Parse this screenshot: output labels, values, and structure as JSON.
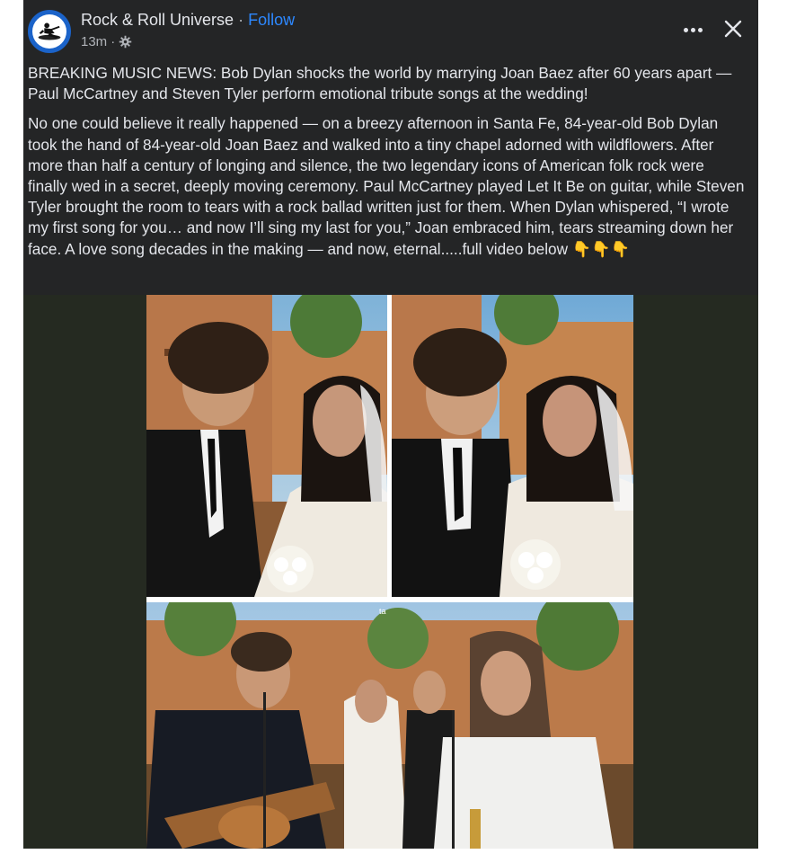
{
  "header": {
    "page_name": "Rock & Roll Universe",
    "separator": "·",
    "follow_label": "Follow",
    "timestamp": "13m",
    "meta_separator": "·",
    "audience_icon": "gear-icon",
    "more_icon": "more-options-icon",
    "close_icon": "close-icon"
  },
  "post": {
    "headline": "BREAKING MUSIC NEWS: Bob Dylan shocks the world by marrying Joan Baez after 60 years apart — Paul McCartney and Steven Tyler perform emotional tribute songs at the wedding!",
    "body": "No one could believe it really happened — on a breezy afternoon in Santa Fe, 84-year-old Bob Dylan took the hand of 84-year-old Joan Baez and walked into a tiny chapel adorned with wildflowers. After more than half a century of longing and silence, the two legendary icons of American folk rock were finally wed in a secret, deeply moving ceremony. Paul McCartney played Let It Be on guitar, while Steven Tyler brought the room to tears with a rock ballad written just for them. When Dylan whispered, “I wrote my first song for you… and now I’ll sing my last for you,” Joan embraced him, tears streaming down her face. A love song decades in the making — and now, eternal.....full video below",
    "emoji": "👇👇👇"
  },
  "media": {
    "watermark": "ta",
    "photos": [
      "wedding-couple-photo-left",
      "wedding-couple-photo-right",
      "wedding-performance-photo"
    ]
  },
  "colors": {
    "card_bg": "#242526",
    "text": "#e4e6eb",
    "muted": "#b0b3b8",
    "follow": "#2d88ff",
    "media_bg": "#252a21"
  }
}
